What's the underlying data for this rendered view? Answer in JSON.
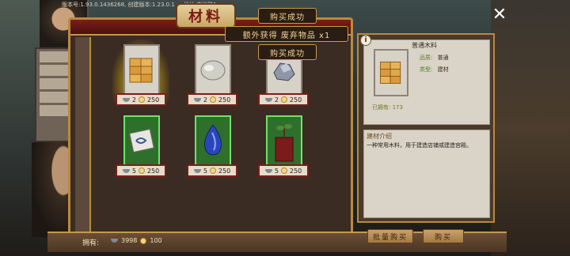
{
  "header": {
    "version_text": "版本号:1.93.0.1436268, 创建版本:1.23.0.1 ...  地址:本地路1",
    "title": "材料"
  },
  "toasts": [
    {
      "text": "购买成功"
    },
    {
      "text": "额外获得 废弃物品 x1"
    },
    {
      "text": "购买成功"
    }
  ],
  "items": [
    {
      "name": "wood-block",
      "quality": "normal",
      "bowl": "2",
      "coin": "250",
      "icon": "wood-icon"
    },
    {
      "name": "stone",
      "quality": "normal",
      "bowl": "2",
      "coin": "250",
      "icon": "stone-icon"
    },
    {
      "name": "iron-ore",
      "quality": "normal",
      "bowl": "2",
      "coin": "250",
      "icon": "ore-icon"
    },
    {
      "name": "scroll",
      "quality": "green",
      "bowl": "5",
      "coin": "250",
      "icon": "scroll-icon"
    },
    {
      "name": "blue-crystal",
      "quality": "green",
      "bowl": "5",
      "coin": "250",
      "icon": "crystal-icon"
    },
    {
      "name": "bonsai-box",
      "quality": "green",
      "bowl": "5",
      "coin": "250",
      "icon": "bonsai-icon"
    }
  ],
  "detail": {
    "name": "普通木料",
    "attrs": [
      {
        "label": "品质:",
        "value": "普通"
      },
      {
        "label": "类型:",
        "value": "建材"
      }
    ],
    "owned": "已拥有: 173",
    "section_title": "建材介绍",
    "description": "一种常用木料，用于建造店铺或建造宫殿。"
  },
  "bottom": {
    "owned_label": "拥有:",
    "bowl_amount": "3998",
    "coin_amount": "100",
    "bulk_buy": "批量购买",
    "buy": "购买"
  },
  "colors": {
    "frame_gold": "#b98a3e",
    "title_red": "#7a1812",
    "green_border": "#6ee36a"
  }
}
